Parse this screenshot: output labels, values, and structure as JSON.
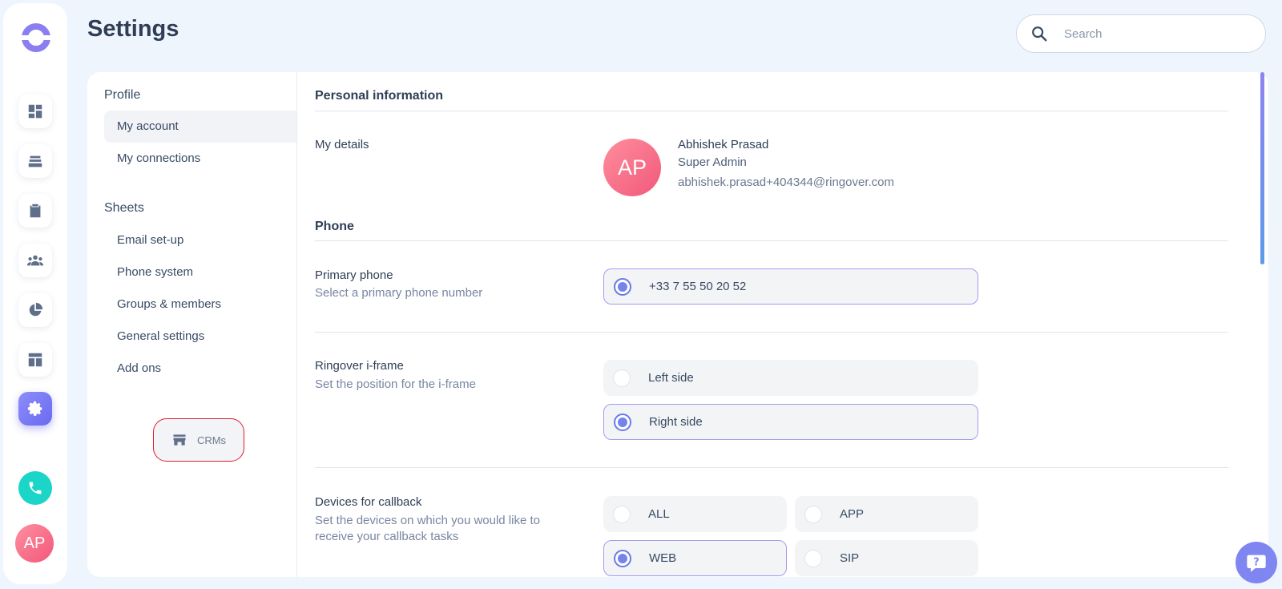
{
  "header": {
    "title": "Settings",
    "search_placeholder": "Search"
  },
  "rail": {
    "icons": [
      "dashboard-icon",
      "inbox-icon",
      "clipboard-icon",
      "team-icon",
      "pie-chart-icon",
      "layout-icon",
      "gear-icon",
      "phone-icon"
    ],
    "avatar_initials": "AP",
    "accent": "#7a7af5",
    "call_color": "#1ad5c8"
  },
  "subnav": {
    "profile_heading": "Profile",
    "profile_items": [
      "My account",
      "My connections"
    ],
    "sheets_heading": "Sheets",
    "sheets_items": [
      "Email set-up",
      "Phone system",
      "Groups & members",
      "General settings",
      "Add ons"
    ],
    "crm_label": "CRMs"
  },
  "personal": {
    "section_title": "Personal information",
    "details_label": "My details",
    "avatar_initials": "AP",
    "name": "Abhishek Prasad",
    "role": "Super Admin",
    "email": "abhishek.prasad+404344@ringover.com"
  },
  "phone": {
    "section_title": "Phone",
    "primary": {
      "label": "Primary phone",
      "sub": "Select a primary phone number",
      "options": [
        {
          "label": "+33 7 55 50 20 52",
          "selected": true
        }
      ]
    },
    "iframe": {
      "label": "Ringover i-frame",
      "sub": "Set the position for the i-frame",
      "options": [
        {
          "label": "Left side",
          "selected": false
        },
        {
          "label": "Right side",
          "selected": true
        }
      ]
    },
    "callback": {
      "label": "Devices for callback",
      "sub_line1": "Set the devices on which you would like to",
      "sub_line2": "receive your callback tasks",
      "options": [
        {
          "label": "ALL",
          "selected": false
        },
        {
          "label": "APP",
          "selected": false
        },
        {
          "label": "WEB",
          "selected": true
        },
        {
          "label": "SIP",
          "selected": false
        }
      ]
    }
  }
}
